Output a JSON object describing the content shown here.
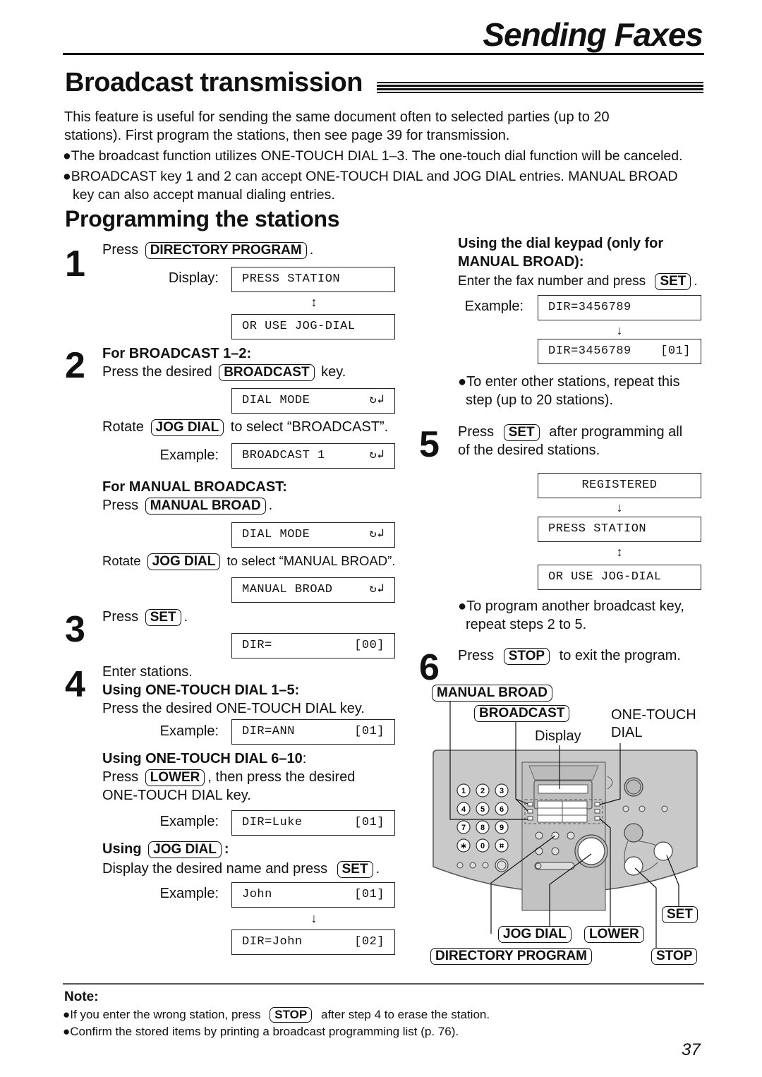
{
  "header": {
    "chapter": "Sending Faxes"
  },
  "section": {
    "title": "Broadcast transmission",
    "intro": [
      "This feature is useful for sending the same document often to selected parties (up to 20",
      "stations). First program the stations, then see page 39 for transmission."
    ],
    "bullets": [
      "●The broadcast function utilizes ONE-TOUCH DIAL 1–3. The one-touch dial function will be canceled.",
      "●BROADCAST key 1 and 2 can accept ONE-TOUCH DIAL and JOG DIAL entries. MANUAL BROAD",
      "key can also accept manual dialing entries."
    ]
  },
  "subsection": {
    "title": "Programming the stations"
  },
  "common": {
    "press": "Press",
    "display_label": "Display:",
    "example_label": "Example:",
    "rotate": "Rotate",
    "period": ".",
    "colon": ":",
    "dial_mode_icon": "↻↲"
  },
  "keys": {
    "directory_program": "DIRECTORY PROGRAM",
    "broadcast": "BROADCAST",
    "jog_dial": "JOG DIAL",
    "manual_broad": "MANUAL BROAD",
    "set": "SET",
    "lower": "LOWER",
    "stop": "STOP"
  },
  "step1": {
    "num": "1",
    "lcd": [
      "PRESS STATION",
      "OR USE JOG-DIAL"
    ]
  },
  "step2": {
    "num": "2",
    "heading_broadcast": "For BROADCAST 1–2:",
    "press_desired": "Press the desired",
    "key_suffix": "key.",
    "lcd_dial_mode": "DIAL MODE",
    "select_broadcast": "to select “BROADCAST”.",
    "lcd_broadcast": "BROADCAST 1",
    "heading_manual": "For MANUAL BROADCAST:",
    "select_manual": "to select “MANUAL BROAD”.",
    "lcd_manual": "MANUAL BROAD"
  },
  "step3": {
    "num": "3",
    "lcd_left": "DIR=",
    "lcd_right": "[00]"
  },
  "step4": {
    "num": "4",
    "enter": "Enter stations.",
    "otd15_heading": "Using ONE-TOUCH DIAL 1–5:",
    "otd15_text": "Press the desired ONE-TOUCH DIAL key.",
    "otd15_lcd_left": "DIR=ANN",
    "otd15_lcd_right": "[01]",
    "otd610_heading": "Using ONE-TOUCH DIAL 6–10",
    "otd610_text1": ", then press the desired",
    "otd610_text2": "ONE-TOUCH DIAL key.",
    "otd610_lcd_left": "DIR=Luke",
    "otd610_lcd_right": "[01]",
    "jog_heading": "Using",
    "jog_text": "Display the desired name and press",
    "jog_lcd1_left": "John",
    "jog_lcd1_right": "[01]",
    "jog_lcd2_left": "DIR=John",
    "jog_lcd2_right": "[02]",
    "keypad_heading1": "Using the dial keypad (only for",
    "keypad_heading2": "MANUAL BROAD):",
    "keypad_text": "Enter the fax number and press",
    "keypad_lcd1": "DIR=3456789",
    "keypad_lcd2_left": "DIR=3456789",
    "keypad_lcd2_right": "[01]",
    "repeat_note1": "●To enter other stations, repeat this",
    "repeat_note2": "step (up to 20 stations)."
  },
  "step5": {
    "num": "5",
    "text1": "after programming all",
    "text2": "of the desired stations.",
    "lcd": [
      "REGISTERED",
      "PRESS STATION",
      "OR USE JOG-DIAL"
    ],
    "note1": "●To program another broadcast key,",
    "note2": "repeat steps 2 to 5."
  },
  "step6": {
    "num": "6",
    "text": "to exit the program."
  },
  "diagram": {
    "labels": {
      "one_touch_1": "ONE-TOUCH",
      "one_touch_2": "DIAL",
      "display": "Display"
    },
    "keypad": [
      "1",
      "2",
      "3",
      "4",
      "5",
      "6",
      "7",
      "8",
      "9",
      "∗",
      "0",
      "⌗"
    ]
  },
  "note": {
    "title": "Note:",
    "line1_a": "●If you enter the wrong station, press",
    "line1_b": "after step 4 to erase the station.",
    "line2": "●Confirm the stored items by printing a broadcast programming list (p. 76)."
  },
  "page_number": "37"
}
